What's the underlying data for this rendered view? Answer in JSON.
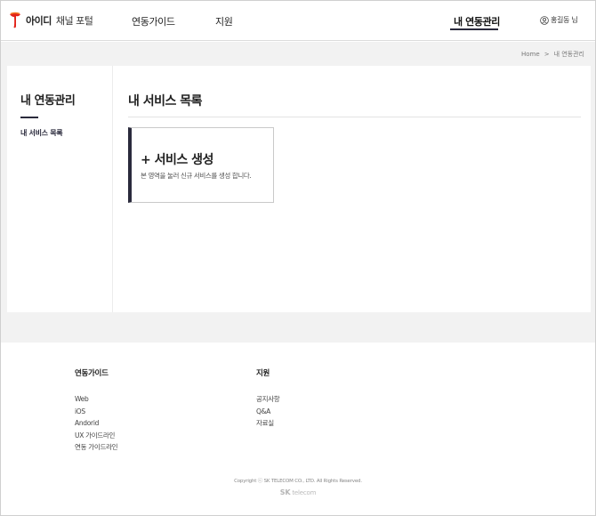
{
  "header": {
    "brand": "아이디",
    "brand_sub": "채널 포털",
    "nav": {
      "guide": "연동가이드",
      "support": "지원",
      "mine": "내 연동관리"
    },
    "user_name": "홍길동 님"
  },
  "breadcrumb": {
    "home": "Home",
    "separator": ">",
    "current": "내 연동관리"
  },
  "sidebar": {
    "title": "내 연동관리",
    "items": [
      {
        "label": "내 서비스 목록"
      }
    ]
  },
  "main": {
    "title": "내 서비스 목록",
    "create_card": {
      "title": "+ 서비스 생성",
      "description": "본 영역을 눌러 신규 서비스를 생성 합니다."
    }
  },
  "footer": {
    "col1": {
      "heading": "연동가이드",
      "links": [
        "Web",
        "iOS",
        "Andorid",
        "UX 가이드라인",
        "연동 가이드라인"
      ]
    },
    "col2": {
      "heading": "지원",
      "links": [
        "공지사항",
        "Q&A",
        "자료실"
      ]
    },
    "copyright": "Copyright ⓒ SK TELECOM CO., LTD. All Rights Reserved.",
    "sk_logo": {
      "mark": "SK",
      "text": "telecom"
    }
  },
  "colors": {
    "accent": "#2a2a3c",
    "brand_orange": "#f47725",
    "brand_red": "#e2231a",
    "background_gray": "#f2f2f2"
  }
}
